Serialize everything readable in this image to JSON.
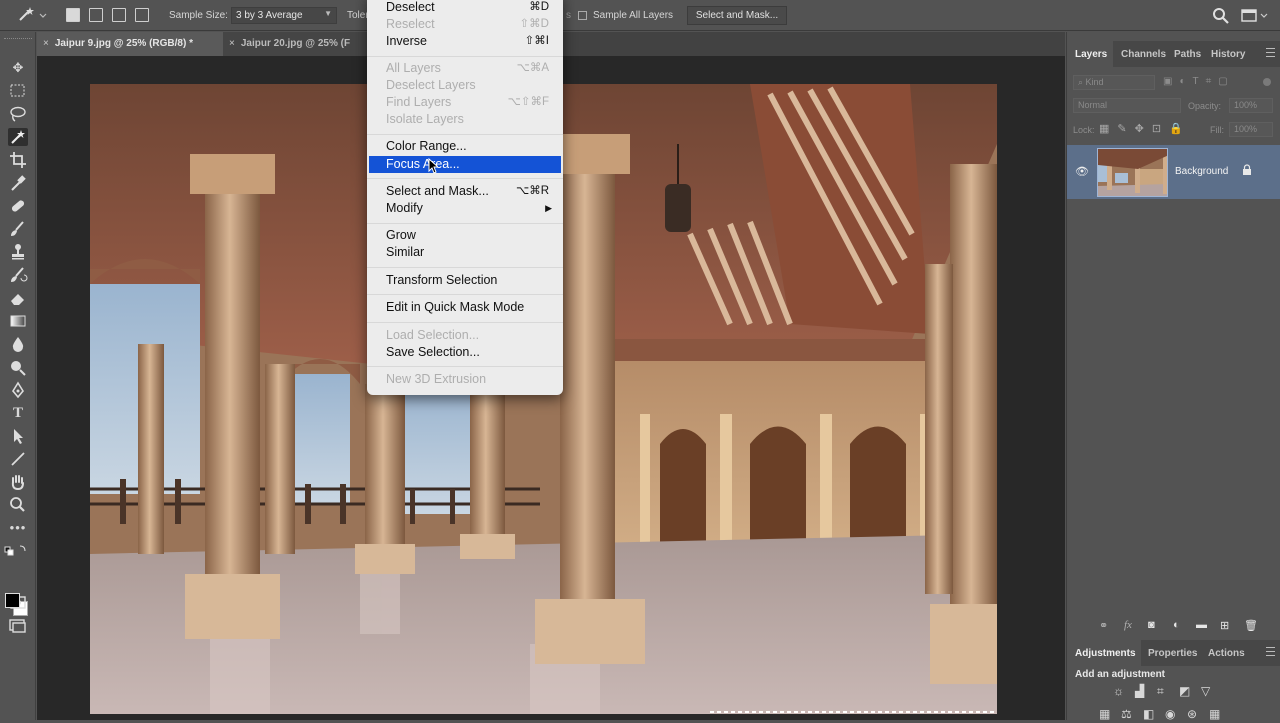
{
  "options_bar": {
    "sample_size_label": "Sample Size:",
    "sample_size_value": "3 by 3 Average",
    "tolerance_label": "Toler",
    "sample_all_layers_label": "Sample All Layers",
    "select_and_mask_button": "Select and Mask..."
  },
  "document_tabs": [
    {
      "close": "×",
      "title": "Jaipur 9.jpg @ 25% (RGB/8) *"
    },
    {
      "close": "×",
      "title": "Jaipur 20.jpg @ 25% (F"
    }
  ],
  "select_menu": {
    "items": [
      {
        "label": "Deselect",
        "shortcut": "⌘D",
        "enabled": true
      },
      {
        "label": "Reselect",
        "shortcut": "⇧⌘D",
        "enabled": false
      },
      {
        "label": "Inverse",
        "shortcut": "⇧⌘I",
        "enabled": true
      },
      {
        "label": "All Layers",
        "shortcut": "⌥⌘A",
        "enabled": false
      },
      {
        "label": "Deselect Layers",
        "shortcut": "",
        "enabled": false
      },
      {
        "label": "Find Layers",
        "shortcut": "⌥⇧⌘F",
        "enabled": false
      },
      {
        "label": "Isolate Layers",
        "shortcut": "",
        "enabled": false
      },
      {
        "label": "Color Range...",
        "shortcut": "",
        "enabled": true
      },
      {
        "label": "Focus Area...",
        "shortcut": "",
        "enabled": true,
        "highlighted": true
      },
      {
        "label": "Select and Mask...",
        "shortcut": "⌥⌘R",
        "enabled": true
      },
      {
        "label": "Modify",
        "shortcut": "",
        "enabled": true,
        "submenu": "▶"
      },
      {
        "label": "Grow",
        "shortcut": "",
        "enabled": true
      },
      {
        "label": "Similar",
        "shortcut": "",
        "enabled": true
      },
      {
        "label": "Transform Selection",
        "shortcut": "",
        "enabled": true
      },
      {
        "label": "Edit in Quick Mask Mode",
        "shortcut": "",
        "enabled": true
      },
      {
        "label": "Load Selection...",
        "shortcut": "",
        "enabled": false
      },
      {
        "label": "Save Selection...",
        "shortcut": "",
        "enabled": true
      },
      {
        "label": "New 3D Extrusion",
        "shortcut": "",
        "enabled": false
      }
    ]
  },
  "layers_panel": {
    "tabs": [
      "Layers",
      "Channels",
      "Paths",
      "History"
    ],
    "active_tab": "Layers",
    "filter_placeholder": "Kind",
    "blend_mode": "Normal",
    "opacity_label": "Opacity:",
    "opacity_value": "100%",
    "lock_label": "Lock:",
    "fill_label": "Fill:",
    "fill_value": "100%",
    "layer_name": "Background"
  },
  "adjustments_panel": {
    "tabs": [
      "Adjustments",
      "Properties",
      "Actions"
    ],
    "active_tab": "Adjustments",
    "add_label": "Add an adjustment"
  },
  "colors": {
    "accent": "#1453d6",
    "panel_bg": "#535353",
    "selected_layer": "#5c6f8a"
  }
}
